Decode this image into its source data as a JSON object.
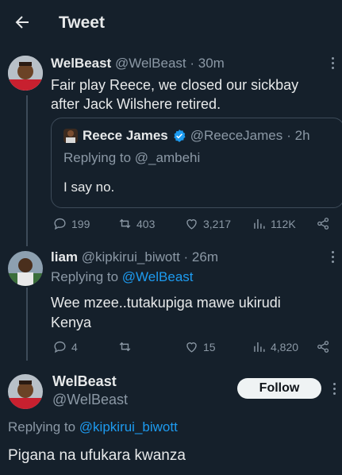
{
  "header": {
    "title": "Tweet"
  },
  "tweet1": {
    "name": "WelBeast",
    "handle": "@WelBeast",
    "time": "· 30m",
    "text_line1": "Fair play Reece, we closed our sickbay",
    "text_line2": "after Jack Wilshere retired.",
    "quote": {
      "name": "Reece James",
      "handle": "@ReeceJames",
      "time": "· 2h",
      "replying_prefix": "Replying to",
      "replying_handle": "@_ambehi",
      "text": "I say no."
    },
    "actions": {
      "replies": "199",
      "retweets": "403",
      "likes": "3,217",
      "views": "112K"
    }
  },
  "tweet2": {
    "name": "liam",
    "handle": "@kipkirui_biwott",
    "time": "· 26m",
    "replying_prefix": "Replying to",
    "replying_handle": "@WelBeast",
    "text_line1": "Wee mzee..tutakupiga mawe ukirudi",
    "text_line2": "Kenya",
    "actions": {
      "replies": "4",
      "retweets": "",
      "likes": "15",
      "views": "4,820"
    }
  },
  "tweet3": {
    "name": "WelBeast",
    "handle": "@WelBeast",
    "follow_label": "Follow",
    "replying_prefix": "Replying to",
    "replying_handle": "@kipkirui_biwott",
    "text": "Pigana na ufukara kwanza"
  },
  "colors": {
    "background": "#15202b",
    "accent": "#1d9bf0",
    "muted": "#8b98a5",
    "verified": "#1d9bf0"
  }
}
